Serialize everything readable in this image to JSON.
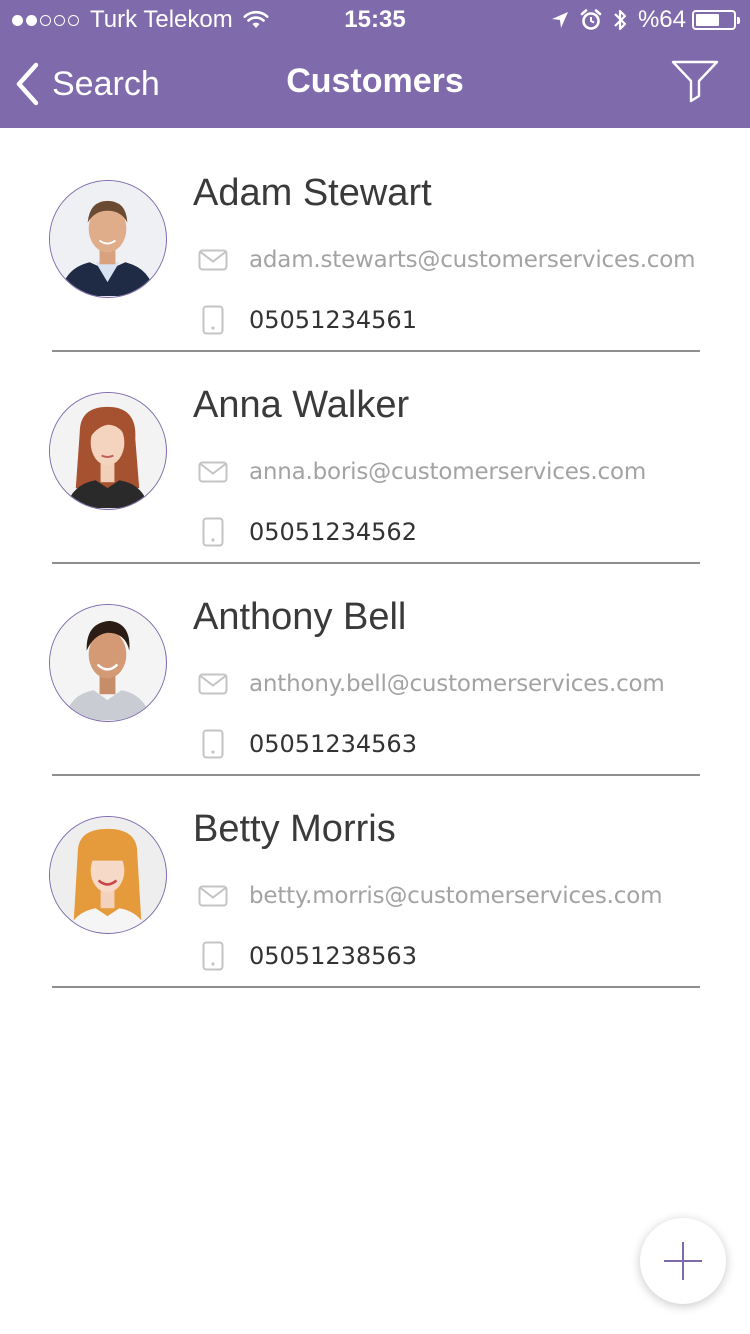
{
  "status_bar": {
    "carrier": "Turk Telekom",
    "time": "15:35",
    "battery_text": "%64",
    "battery_level": 0.64,
    "signal_bars_filled": 2,
    "signal_bars_total": 5,
    "icons": [
      "wifi-icon",
      "location-arrow-icon",
      "alarm-icon",
      "bluetooth-icon",
      "battery-icon"
    ]
  },
  "nav": {
    "back_label": "Search",
    "title": "Customers",
    "back_icon": "chevron-left-icon",
    "filter_icon": "filter-icon"
  },
  "customers": [
    {
      "name": "Adam Stewart",
      "email": "adam.stewarts@customerservices.com",
      "phone": "05051234561"
    },
    {
      "name": "Anna Walker",
      "email": "anna.boris@customerservices.com",
      "phone": "05051234562"
    },
    {
      "name": "Anthony Bell",
      "email": "anthony.bell@customerservices.com",
      "phone": "05051234563"
    },
    {
      "name": "Betty Morris",
      "email": "betty.morris@customerservices.com",
      "phone": "05051238563"
    }
  ],
  "fab": {
    "icon": "plus-icon"
  },
  "colors": {
    "accent": "#7f6aac",
    "name_text": "#3a3a3a",
    "email_text": "#a3a3a3",
    "phone_text": "#333333",
    "divider": "#8e8e8e"
  }
}
